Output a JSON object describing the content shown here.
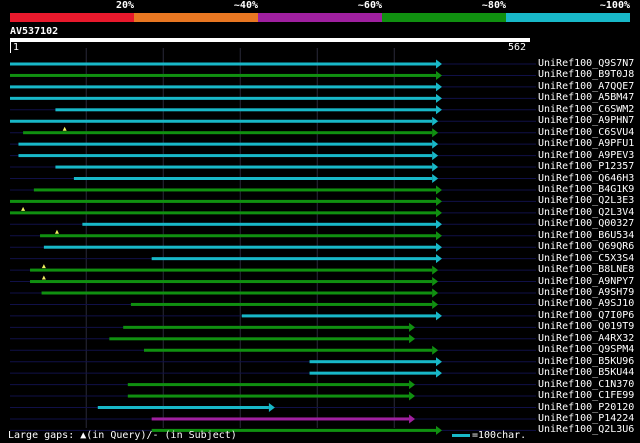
{
  "legend": {
    "colors": [
      "#e8192c",
      "#e87722",
      "#a020a0",
      "#109010",
      "#18b8c8"
    ],
    "labels": [
      "20%",
      "~40%",
      "~60%",
      "~80%",
      "~100%"
    ]
  },
  "query": {
    "id": "AV537102",
    "start": "1",
    "end": "562",
    "length": 562
  },
  "color_map": {
    "cyan": "#18b8c8",
    "green": "#109010",
    "purple": "#a020a0"
  },
  "hits": [
    {
      "label": "UniRef100_Q9S7N7",
      "color": "cyan",
      "start": 1,
      "end": 562,
      "dots": []
    },
    {
      "label": "UniRef100_B9T0J8",
      "color": "green",
      "start": 1,
      "end": 562,
      "dots": []
    },
    {
      "label": "UniRef100_A7QQE7",
      "color": "cyan",
      "start": 1,
      "end": 562,
      "dots": []
    },
    {
      "label": "UniRef100_A5BM47",
      "color": "cyan",
      "start": 1,
      "end": 562,
      "dots": []
    },
    {
      "label": "UniRef100_C6SWM2",
      "color": "cyan",
      "start": 60,
      "end": 562,
      "dots": []
    },
    {
      "label": "UniRef100_A9PHN7",
      "color": "cyan",
      "start": 1,
      "end": 557,
      "dots": []
    },
    {
      "label": "UniRef100_C6SVU4",
      "color": "green",
      "start": 18,
      "end": 557,
      "dots": [
        72
      ]
    },
    {
      "label": "UniRef100_A9PFU1",
      "color": "cyan",
      "start": 12,
      "end": 557,
      "dots": []
    },
    {
      "label": "UniRef100_A9PEV3",
      "color": "cyan",
      "start": 12,
      "end": 557,
      "dots": []
    },
    {
      "label": "UniRef100_P12357",
      "color": "cyan",
      "start": 60,
      "end": 557,
      "dots": []
    },
    {
      "label": "UniRef100_Q646H3",
      "color": "cyan",
      "start": 84,
      "end": 557,
      "dots": []
    },
    {
      "label": "UniRef100_B4G1K9",
      "color": "green",
      "start": 32,
      "end": 562,
      "dots": []
    },
    {
      "label": "UniRef100_Q2L3E3",
      "color": "green",
      "start": 1,
      "end": 562,
      "dots": []
    },
    {
      "label": "UniRef100_Q2L3V4",
      "color": "green",
      "start": 1,
      "end": 562,
      "dots": [
        18
      ]
    },
    {
      "label": "UniRef100_Q00327",
      "color": "cyan",
      "start": 95,
      "end": 562,
      "dots": []
    },
    {
      "label": "UniRef100_B6U534",
      "color": "green",
      "start": 40,
      "end": 562,
      "dots": [
        62
      ]
    },
    {
      "label": "UniRef100_Q69QR6",
      "color": "cyan",
      "start": 45,
      "end": 562,
      "dots": []
    },
    {
      "label": "UniRef100_C5X3S4",
      "color": "cyan",
      "start": 185,
      "end": 562,
      "dots": []
    },
    {
      "label": "UniRef100_B8LNE8",
      "color": "green",
      "start": 27,
      "end": 557,
      "dots": [
        45
      ]
    },
    {
      "label": "UniRef100_A9NPY7",
      "color": "green",
      "start": 27,
      "end": 557,
      "dots": [
        45
      ]
    },
    {
      "label": "UniRef100_A9SH79",
      "color": "green",
      "start": 42,
      "end": 557,
      "dots": []
    },
    {
      "label": "UniRef100_A9SJ10",
      "color": "green",
      "start": 158,
      "end": 557,
      "dots": []
    },
    {
      "label": "UniRef100_Q7I0P6",
      "color": "cyan",
      "start": 302,
      "end": 562,
      "dots": []
    },
    {
      "label": "UniRef100_Q019T9",
      "color": "green",
      "start": 148,
      "end": 527,
      "dots": []
    },
    {
      "label": "UniRef100_A4RX32",
      "color": "green",
      "start": 130,
      "end": 527,
      "dots": []
    },
    {
      "label": "UniRef100_Q9SPM4",
      "color": "green",
      "start": 175,
      "end": 557,
      "dots": []
    },
    {
      "label": "UniRef100_B5KU96",
      "color": "cyan",
      "start": 390,
      "end": 562,
      "dots": []
    },
    {
      "label": "UniRef100_B5KU44",
      "color": "cyan",
      "start": 390,
      "end": 562,
      "dots": []
    },
    {
      "label": "UniRef100_C1N370",
      "color": "green",
      "start": 154,
      "end": 527,
      "dots": []
    },
    {
      "label": "UniRef100_C1FE99",
      "color": "green",
      "start": 154,
      "end": 527,
      "dots": []
    },
    {
      "label": "UniRef100_P20120",
      "color": "cyan",
      "start": 115,
      "end": 345,
      "dots": []
    },
    {
      "label": "UniRef100_P14224",
      "color": "purple",
      "start": 185,
      "end": 527,
      "dots": []
    },
    {
      "label": "UniRef100_Q2L3U6",
      "color": "green",
      "start": 185,
      "end": 562,
      "dots": []
    }
  ],
  "footer": {
    "gaps_text": "Large gaps: ▲(in Query)/- (in Subject)",
    "scale_text": "=100char."
  }
}
